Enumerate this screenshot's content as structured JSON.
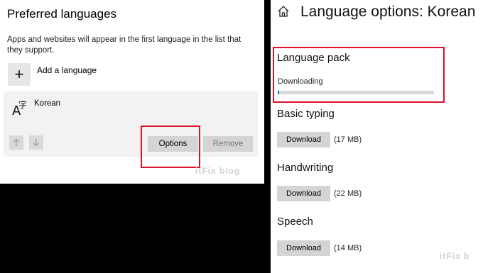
{
  "left_panel": {
    "title": "Preferred languages",
    "description": "Apps and websites will appear in the first language in the list that they support.",
    "add_language": {
      "icon": "plus-icon",
      "label": "Add a language"
    },
    "language_item": {
      "icon": "language-glyph-icon",
      "name": "Korean",
      "move_up_icon": "arrow-up-icon",
      "move_down_icon": "arrow-down-icon",
      "options_label": "Options",
      "remove_label": "Remove"
    },
    "watermark": "itFix blog"
  },
  "right_panel": {
    "home_icon": "home-icon",
    "title": "Language options: Korean",
    "language_pack": {
      "title": "Language pack",
      "status": "Downloading",
      "progress": 0.01
    },
    "features": [
      {
        "title": "Basic typing",
        "button": "Download",
        "size": "(17 MB)"
      },
      {
        "title": "Handwriting",
        "button": "Download",
        "size": "(22 MB)"
      },
      {
        "title": "Speech",
        "button": "Download",
        "size": "(14 MB)"
      }
    ],
    "watermark": "itFix b"
  },
  "colors": {
    "highlight": "#e0102a",
    "progress": "#0078d7",
    "button": "#d4d4d4",
    "backdrop": "#000000"
  }
}
